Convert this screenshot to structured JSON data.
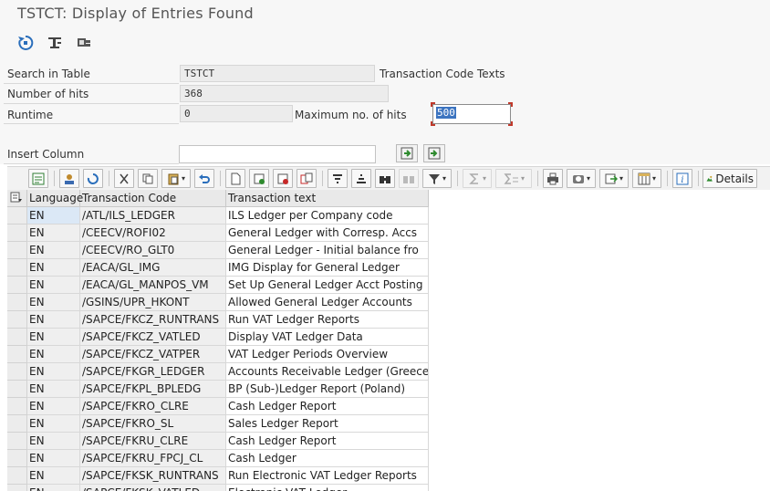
{
  "title": "TSTCT: Display of Entries Found",
  "toolbar": {
    "icons": [
      "refresh-icon",
      "selection-options-icon",
      "filter-settings-icon"
    ]
  },
  "form": {
    "search_label": "Search in Table",
    "table_value": "TSTCT",
    "table_desc": "Transaction Code Texts",
    "hits_label": "Number of hits",
    "hits_value": "368",
    "runtime_label": "Runtime",
    "runtime_value": "0",
    "maxhits_label": "Maximum no. of hits",
    "maxhits_value": "500",
    "insert_label": "Insert Column",
    "insert_value": ""
  },
  "alv_toolbar": {
    "details_label": "Details"
  },
  "grid": {
    "columns": [
      "Language",
      "Transaction Code",
      "Transaction text"
    ],
    "rows": [
      [
        "EN",
        "/ATL/ILS_LEDGER",
        "ILS Ledger per Company code"
      ],
      [
        "EN",
        "/CEECV/ROFI02",
        "General Ledger  with Corresp. Accs"
      ],
      [
        "EN",
        "/CEECV/RO_GLT0",
        "General Ledger - Initial balance fro"
      ],
      [
        "EN",
        "/EACA/GL_IMG",
        "IMG Display for General Ledger"
      ],
      [
        "EN",
        "/EACA/GL_MANPOS_VM",
        "Set Up General Ledger Acct Posting"
      ],
      [
        "EN",
        "/GSINS/UPR_HKONT",
        "Allowed General Ledger Accounts"
      ],
      [
        "EN",
        "/SAPCE/FKCZ_RUNTRANS",
        "Run VAT Ledger Reports"
      ],
      [
        "EN",
        "/SAPCE/FKCZ_VATLED",
        "Display VAT Ledger Data"
      ],
      [
        "EN",
        "/SAPCE/FKCZ_VATPER",
        "VAT Ledger Periods Overview"
      ],
      [
        "EN",
        "/SAPCE/FKGR_LEDGER",
        "Accounts Receivable Ledger (Greece)"
      ],
      [
        "EN",
        "/SAPCE/FKPL_BPLEDG",
        "BP (Sub-)Ledger Report (Poland)"
      ],
      [
        "EN",
        "/SAPCE/FKRO_CLRE",
        "Cash Ledger Report"
      ],
      [
        "EN",
        "/SAPCE/FKRO_SL",
        "Sales Ledger Report"
      ],
      [
        "EN",
        "/SAPCE/FKRU_CLRE",
        "Cash Ledger Report"
      ],
      [
        "EN",
        "/SAPCE/FKRU_FPCJ_CL",
        "Cash Ledger"
      ],
      [
        "EN",
        "/SAPCE/FKSK_RUNTRANS",
        "Run Electronic VAT Ledger Reports"
      ],
      [
        "EN",
        "/SAPCE/FKSK_VATLED",
        "Electronic VAT Ledger"
      ]
    ]
  }
}
